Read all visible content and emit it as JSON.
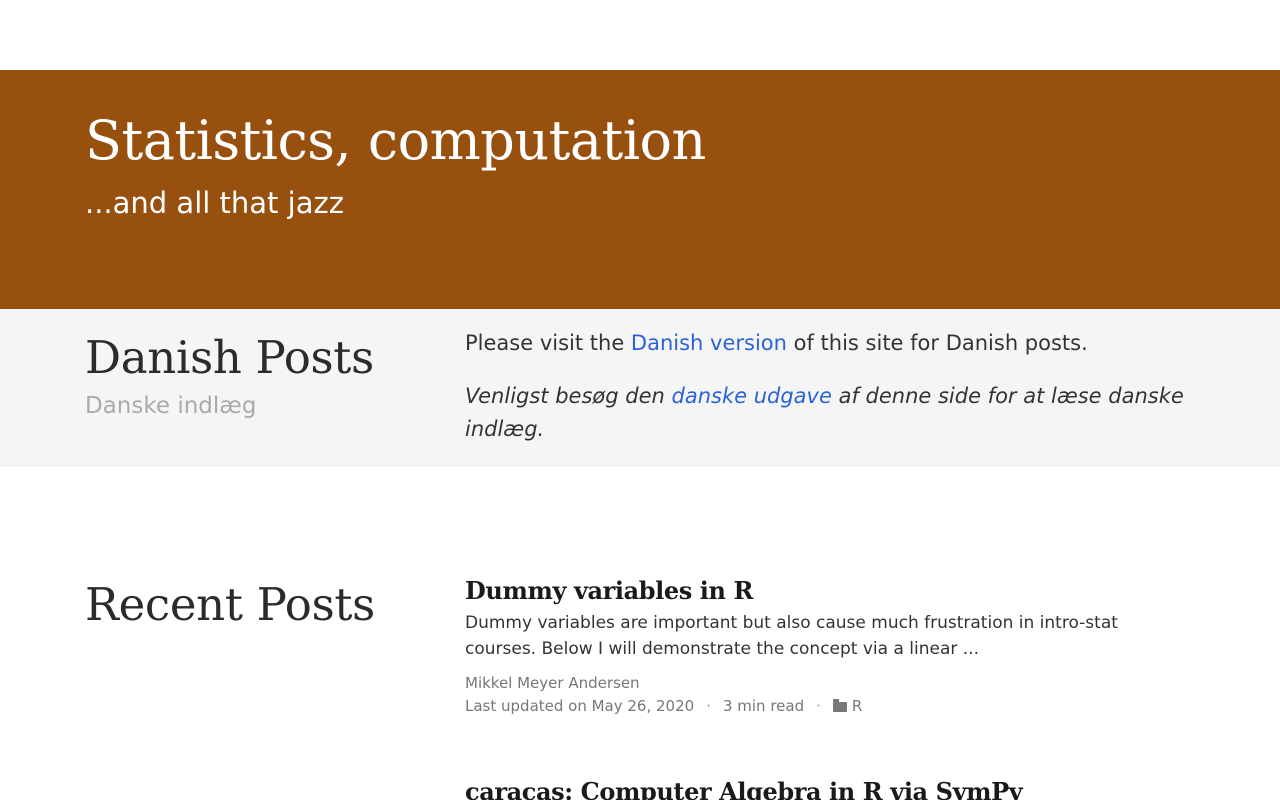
{
  "hero": {
    "title": "Statistics, computation",
    "subtitle": "...and all that jazz",
    "background": "#97500e"
  },
  "danish": {
    "title": "Danish Posts",
    "subtitle": "Danske indlæg",
    "line1_prefix": "Please visit the ",
    "line1_link": "Danish version",
    "line1_suffix": " of this site for Danish posts.",
    "line2_prefix": "Venligst besøg den ",
    "line2_link": "danske udgave",
    "line2_suffix": " af denne side for at læse danske indlæg."
  },
  "recent": {
    "title": "Recent Posts",
    "posts": [
      {
        "title": "Dummy variables in R",
        "summary": "Dummy variables are important but also cause much frustration in intro-stat courses. Below I will demonstrate the concept via a linear ...",
        "author": "Mikkel Meyer Andersen",
        "updated": "Last updated on May 26, 2020",
        "read_time": "3 min read",
        "category": "R"
      },
      {
        "title": "caracas: Computer Algebra in R via SymPy"
      }
    ]
  },
  "colors": {
    "accent": "#97500e",
    "link": "#2a62d8"
  },
  "icons": {
    "category": "folder-icon"
  }
}
